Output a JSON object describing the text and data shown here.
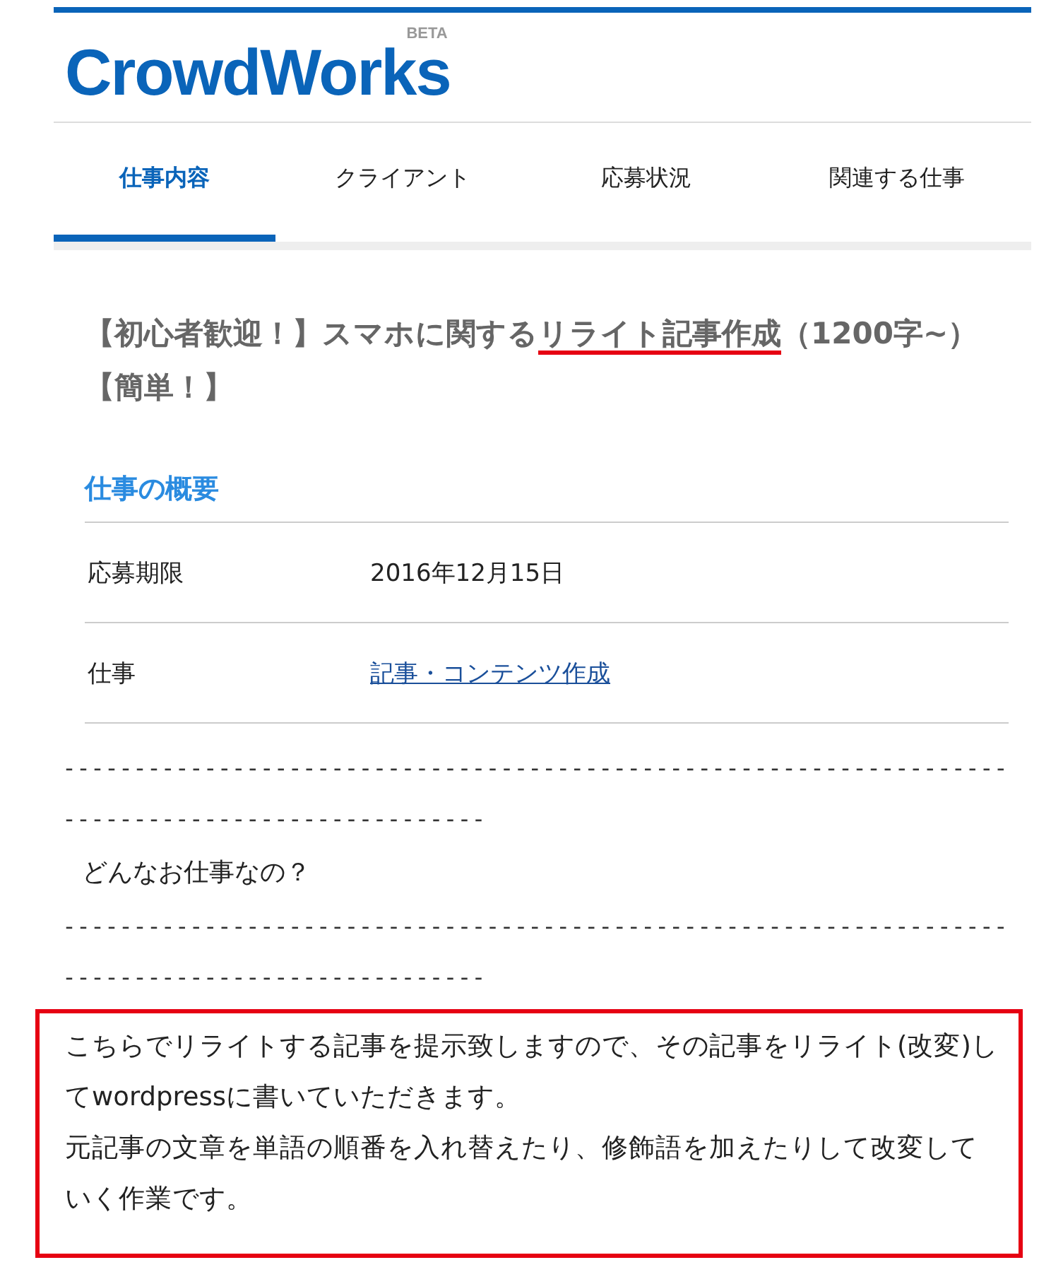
{
  "logo": {
    "name": "CrowdWorks",
    "badge": "BETA"
  },
  "tabs": [
    {
      "label": "仕事内容",
      "selected": true
    },
    {
      "label": "クライアント",
      "selected": false
    },
    {
      "label": "応募状況",
      "selected": false
    },
    {
      "label": "関連する仕事",
      "selected": false
    }
  ],
  "title": {
    "before": "【初心者歓迎！】スマホに関する",
    "highlighted": "リライト記事作成",
    "after": "（1200字~）【簡単！】"
  },
  "overview": {
    "heading": "仕事の概要",
    "rows": [
      {
        "label": "応募期限",
        "value": "2016年12月15日",
        "kind": "text"
      },
      {
        "label": "仕事",
        "value": "記事・コンテンツ作成",
        "kind": "link"
      }
    ]
  },
  "divider_top": [
    "-------------------------------------------------------------------",
    "------------------------------"
  ],
  "question": "どんなお仕事なの？",
  "divider_bottom": [
    "-------------------------------------------------------------------",
    "------------------------------"
  ],
  "description": {
    "highlighted": true,
    "paragraphs": [
      "こちらでリライトする記事を提示致しますので、その記事をリライト(改変)してwordpressに書いていただきます。",
      "元記事の文章を単語の順番を入れ替えたり、修飾語を加えたりして改変していく作業です。"
    ]
  }
}
